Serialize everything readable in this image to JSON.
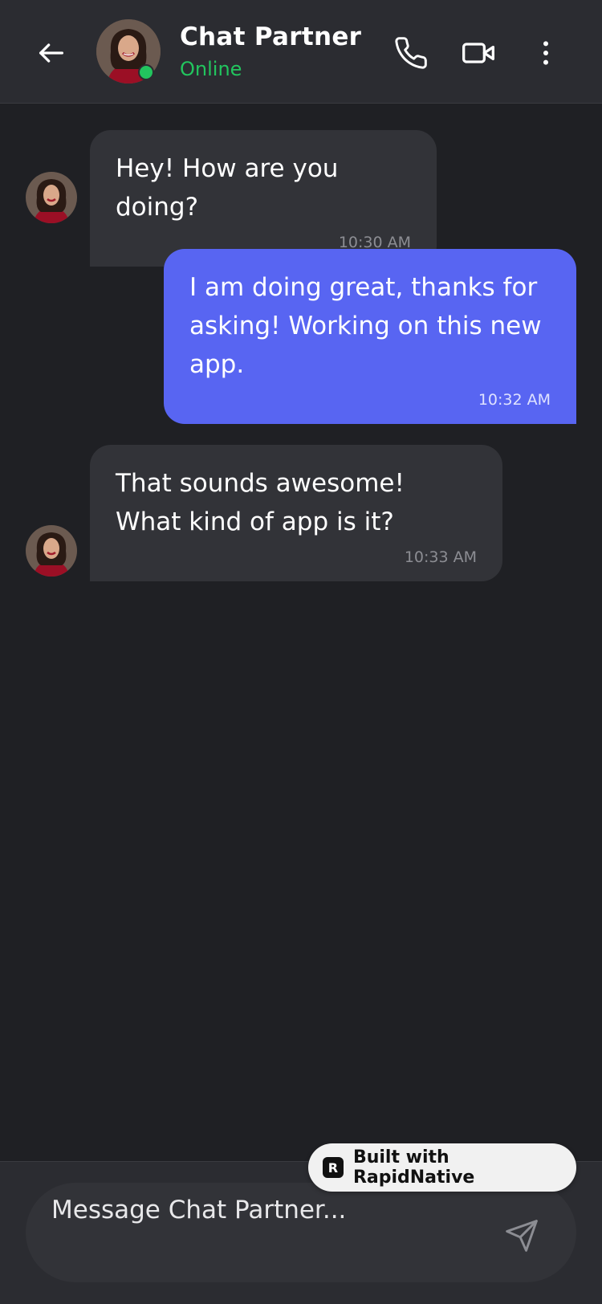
{
  "header": {
    "title": "Chat Partner",
    "status": "Online",
    "status_color": "#22c55e",
    "icons": [
      "arrow-left-icon",
      "phone-icon",
      "video-icon",
      "more-vertical-icon"
    ]
  },
  "messages": [
    {
      "direction": "incoming",
      "text": "Hey! How are you doing?",
      "time": "10:30 AM"
    },
    {
      "direction": "outgoing",
      "text": "I am doing great, thanks for asking! Working on this new app.",
      "time": "10:32 AM"
    },
    {
      "direction": "incoming",
      "text": "That sounds awesome! What kind of app is it?",
      "time": "10:33 AM"
    }
  ],
  "composer": {
    "placeholder": "Message Chat Partner...",
    "send_icon": "send-icon"
  },
  "badge": {
    "label": "Built with RapidNative",
    "logo_letter": "R"
  },
  "colors": {
    "background": "#1f2024",
    "header": "#2b2c31",
    "incoming_bubble": "#323338",
    "outgoing_bubble": "#5865f2",
    "online": "#22c55e"
  }
}
